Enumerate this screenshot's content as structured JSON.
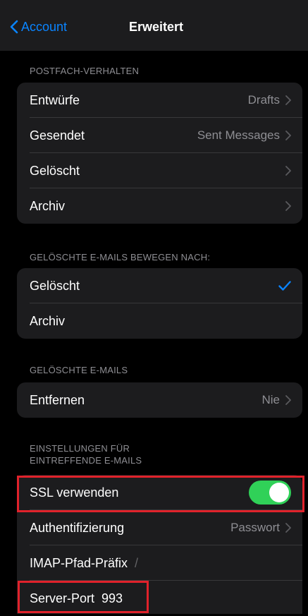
{
  "nav": {
    "back_label": "Account",
    "title": "Erweitert"
  },
  "mailbox_behavior": {
    "header": "POSTFACH-VERHALTEN",
    "rows": [
      {
        "label": "Entwürfe",
        "value": "Drafts"
      },
      {
        "label": "Gesendet",
        "value": "Sent Messages"
      },
      {
        "label": "Gelöscht",
        "value": ""
      },
      {
        "label": "Archiv",
        "value": ""
      }
    ]
  },
  "move_deleted": {
    "header": "GELÖSCHTE E-MAILS BEWEGEN NACH:",
    "rows": [
      {
        "label": "Gelöscht",
        "selected": true
      },
      {
        "label": "Archiv",
        "selected": false
      }
    ]
  },
  "deleted_mails": {
    "header": "GELÖSCHTE E-MAILS",
    "rows": [
      {
        "label": "Entfernen",
        "value": "Nie"
      }
    ]
  },
  "incoming": {
    "header_line1": "EINSTELLUNGEN FÜR",
    "header_line2": "EINTREFFENDE E-MAILS",
    "ssl_label": "SSL verwenden",
    "ssl_enabled": true,
    "auth_label": "Authentifizierung",
    "auth_value": "Passwort",
    "imap_prefix_label": "IMAP-Pfad-Präfix",
    "imap_prefix_placeholder": "/",
    "server_port_label": "Server-Port",
    "server_port_value": "993"
  },
  "colors": {
    "accent": "#0a84ff",
    "toggle_on": "#30d158",
    "highlight": "#e0222b",
    "background": "#000000",
    "group_background": "#1c1c1e",
    "secondary_text": "#8e8e93"
  }
}
